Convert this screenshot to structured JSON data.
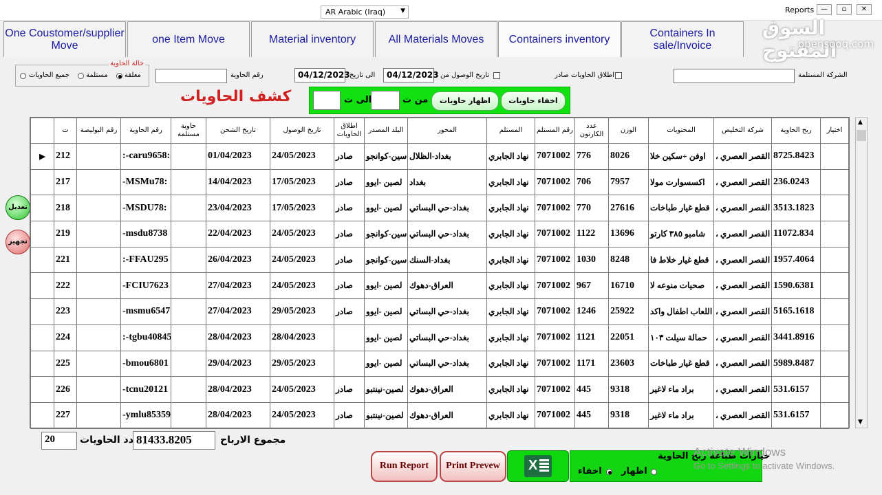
{
  "window": {
    "title": "Reports",
    "language_select": "AR Arabic (Iraq)",
    "watermark_ar": "السوق المفتوح",
    "watermark_en": "opensooq.com"
  },
  "tabs": [
    {
      "label": "One Coustomer/supplier Move"
    },
    {
      "label": "one Item Move"
    },
    {
      "label": "Material inventory"
    },
    {
      "label": "All Materials Moves"
    },
    {
      "label": "Containers inventory",
      "active": true
    },
    {
      "label": "Containers In sale/Invoice"
    }
  ],
  "filters": {
    "container_status_title": "حالة الحاوية",
    "status_options": [
      {
        "label": "معلقة",
        "selected": true
      },
      {
        "label": "مستلمة",
        "selected": false
      },
      {
        "label": "جميع الحاويات",
        "selected": false
      }
    ],
    "container_no_label": "رقم الحاوية",
    "container_no_value": "",
    "to_date_label": "الى تاريخ",
    "to_date_value": "04/12/2023",
    "from_arrival_label": "تاريخ الوصول من",
    "from_arrival_value": "04/12/2023",
    "release_label": "اطلاق الحاويات صادر",
    "company_label": "الشركة المستلمة",
    "company_value": ""
  },
  "report_title": "كشف الحاويات",
  "range_box": {
    "hide_button": "اخفاء حاويات",
    "show_button": "اظهار حاويات",
    "from_label": "من ت",
    "to_label": "الى ت",
    "from_value": "",
    "to_value": ""
  },
  "grid": {
    "headers": [
      "ت",
      "رقم البوليصة",
      "رقم الحاوية",
      "حاوية مستلمة",
      "تاريخ الشحن",
      "تاريخ الوصول",
      "اطلاق الحاويات",
      "البلد المصدر",
      "المحور",
      "المستلم",
      "رقم المستلم",
      "عدد الكارتون",
      "الوزن",
      "المحتويات",
      "شركة التخليص",
      "ربح الحاوية",
      "اختيار"
    ],
    "rows": [
      {
        "no": "212",
        "policy": "",
        "container": ":-caru9658:",
        "received": "",
        "ship": "01/04/2023",
        "arrival": "24/05/2023",
        "release": "صادر",
        "country": "سين-كوانجو",
        "axis": "بغداد-الظلال",
        "receiver": "نهاد الجابري",
        "recv_no": "7071002",
        "cartons": "776",
        "weight": "8026",
        "contents": "اوفن +سكين خلا",
        "clearance": "، القصر العصري",
        "profit": "8725.8423",
        "pointer": "▶"
      },
      {
        "no": "217",
        "policy": "",
        "container": "-MSMu78:",
        "received": "",
        "ship": "14/04/2023",
        "arrival": "17/05/2023",
        "release": "صادر",
        "country": "لصين -ايوو",
        "axis": "بغداد",
        "receiver": "نهاد الجابري",
        "recv_no": "7071002",
        "cartons": "706",
        "weight": "7957",
        "contents": "اكسسوارت مولا",
        "clearance": "، القصر العصري",
        "profit": "236.0243",
        "pointer": ""
      },
      {
        "no": "218",
        "policy": "",
        "container": "-MSDU78:",
        "received": "",
        "ship": "23/04/2023",
        "arrival": "17/05/2023",
        "release": "صادر",
        "country": "لصين -ايوو",
        "axis": "بغداد-حي البساتي",
        "receiver": "نهاد الجابري",
        "recv_no": "7071002",
        "cartons": "770",
        "weight": "27616",
        "contents": "قطع غيار طباخات",
        "clearance": "، القصر العصري",
        "profit": "3513.1823",
        "pointer": ""
      },
      {
        "no": "219",
        "policy": "",
        "container": "-msdu8738",
        "received": "",
        "ship": "22/04/2023",
        "arrival": "24/05/2023",
        "release": "صادر",
        "country": "سين-كوانجو",
        "axis": "بغداد-حي البساتي",
        "receiver": "نهاد الجابري",
        "recv_no": "7071002",
        "cartons": "1122",
        "weight": "13696",
        "contents": "شامبو ٣٨٥ كارتو",
        "clearance": "، القصر العصري",
        "profit": "11072.834",
        "pointer": ""
      },
      {
        "no": "221",
        "policy": "",
        "container": ":-FFAU295",
        "received": "",
        "ship": "26/04/2023",
        "arrival": "24/05/2023",
        "release": "صادر",
        "country": "سين-كوانجو",
        "axis": "بغداد-السنك",
        "receiver": "نهاد الجابري",
        "recv_no": "7071002",
        "cartons": "1030",
        "weight": "8248",
        "contents": "قطع غيار خلاط فا",
        "clearance": "، القصر العصري",
        "profit": "1957.4064",
        "pointer": ""
      },
      {
        "no": "222",
        "policy": "",
        "container": "-FCIU7623",
        "received": "",
        "ship": "27/04/2023",
        "arrival": "24/05/2023",
        "release": "صادر",
        "country": "لصين -ايوو",
        "axis": "العراق-دهوك",
        "receiver": "نهاد الجابري",
        "recv_no": "7071002",
        "cartons": "967",
        "weight": "16710",
        "contents": "صحيات منوعه لا",
        "clearance": "، القصر العصري",
        "profit": "1590.6381",
        "pointer": ""
      },
      {
        "no": "223",
        "policy": "",
        "container": "-msmu6547",
        "received": "",
        "ship": "27/04/2023",
        "arrival": "29/05/2023",
        "release": "صادر",
        "country": "لصين -ايوو",
        "axis": "بغداد-حي البساتي",
        "receiver": "نهاد الجابري",
        "recv_no": "7071002",
        "cartons": "1246",
        "weight": "25922",
        "contents": "اللعاب اطفال واكد",
        "clearance": "، القصر العصري",
        "profit": "5165.1618",
        "pointer": ""
      },
      {
        "no": "224",
        "policy": "",
        "container": ":-tgbu40845",
        "received": "",
        "ship": "28/04/2023",
        "arrival": "28/04/2023",
        "release": "",
        "country": "لصين -ايوو",
        "axis": "بغداد-حي البساتي",
        "receiver": "نهاد الجابري",
        "recv_no": "7071002",
        "cartons": "1121",
        "weight": "22051",
        "contents": "حمالة سيلت ١٠٣",
        "clearance": "، القصر العصري",
        "profit": "3441.8916",
        "pointer": ""
      },
      {
        "no": "225",
        "policy": "",
        "container": "-bmou6801",
        "received": "",
        "ship": "29/04/2023",
        "arrival": "29/05/2023",
        "release": "",
        "country": "لصين -ايوو",
        "axis": "بغداد-حي البساتي",
        "receiver": "نهاد الجابري",
        "recv_no": "7071002",
        "cartons": "1171",
        "weight": "23603",
        "contents": "قطع غيار طباخات",
        "clearance": "، القصر العصري",
        "profit": "5989.8487",
        "pointer": ""
      },
      {
        "no": "226",
        "policy": "",
        "container": "-tcnu20121",
        "received": "",
        "ship": "28/04/2023",
        "arrival": "24/05/2023",
        "release": "صادر",
        "country": "لصين-نينتبو",
        "axis": "العراق-دهوك",
        "receiver": "نهاد الجابري",
        "recv_no": "7071002",
        "cartons": "445",
        "weight": "9318",
        "contents": "براد ماء لاغير",
        "clearance": "، القصر العصري",
        "profit": "531.6157",
        "pointer": ""
      },
      {
        "no": "227",
        "policy": "",
        "container": "-ymlu85359",
        "received": "",
        "ship": "28/04/2023",
        "arrival": "24/05/2023",
        "release": "صادر",
        "country": "لصين-نينتبو",
        "axis": "العراق-دهوك",
        "receiver": "نهاد الجابري",
        "recv_no": "7071002",
        "cartons": "445",
        "weight": "9318",
        "contents": "براد ماء لاغير",
        "clearance": "، القصر العصري",
        "profit": "531.6157",
        "pointer": ""
      }
    ]
  },
  "side_buttons": {
    "edit": "تعديل",
    "prepare": "تجهيز"
  },
  "footer": {
    "count_value": "20",
    "count_label": "عدد الحاويات",
    "profit_total": "81433.8205",
    "profit_label": "مجموع الارباح",
    "run_report": "Run Report",
    "print_preview": "Print Prevew",
    "print_options_label": "خيارات طباعة ربح الحاوية",
    "show_label": "اظهار",
    "hide_label": "اخفاء",
    "activate_title": "Activate Windows",
    "activate_sub": "Go to Settings to activate Windows."
  },
  "colors": {
    "tab_text": "#1a1aa0",
    "title_red": "#d02020",
    "green_panel": "#11e011"
  }
}
